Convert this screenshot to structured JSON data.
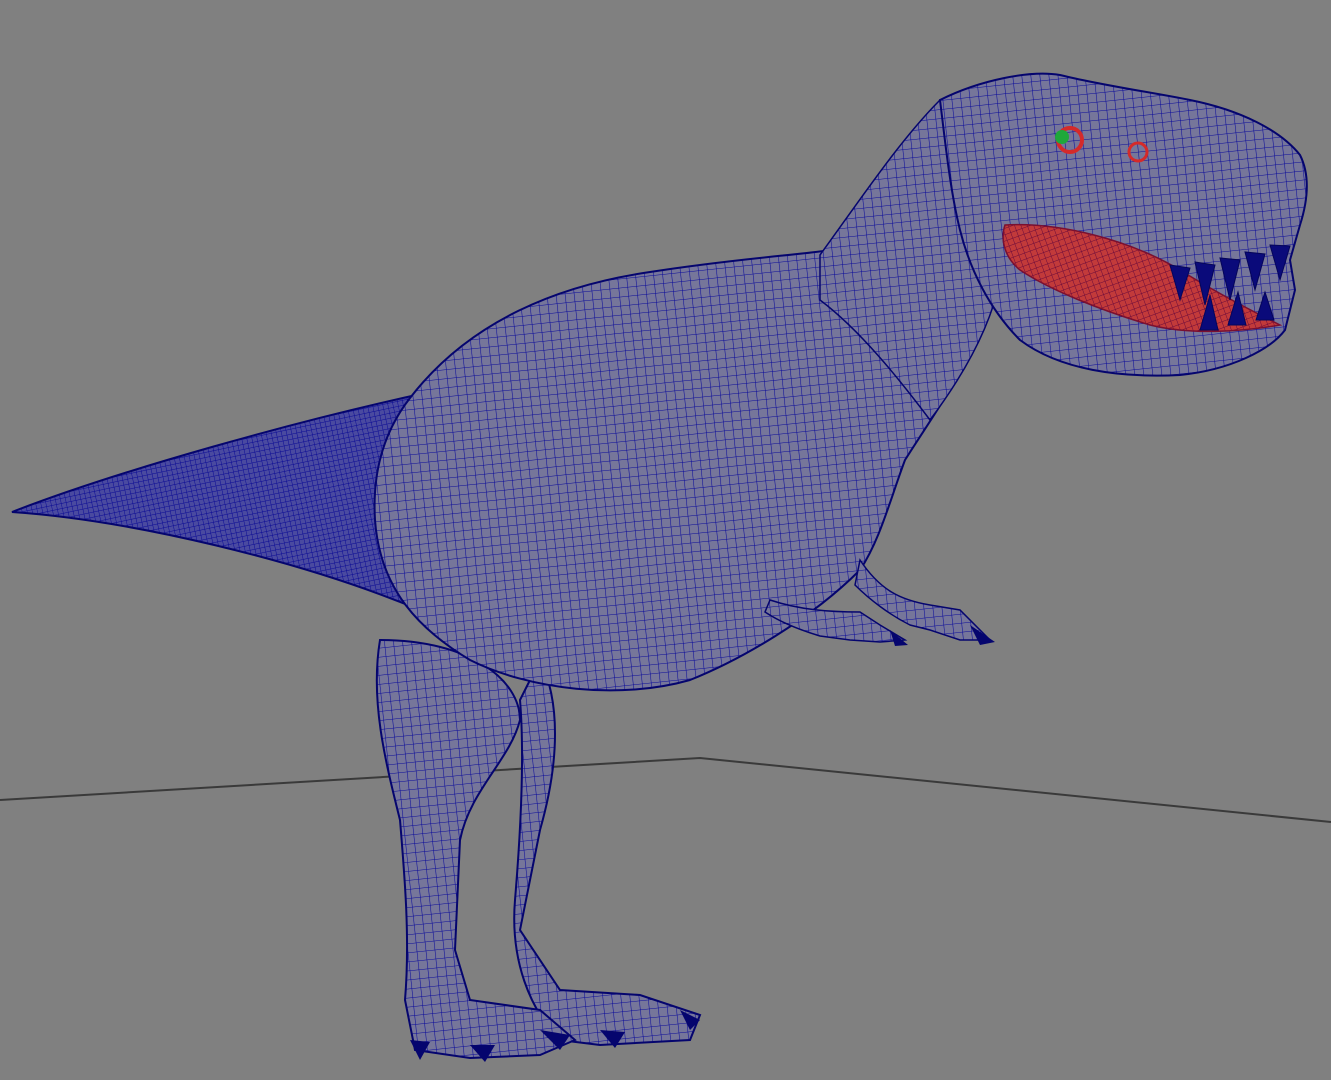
{
  "viewport": {
    "background_color": "#808080",
    "grid_line_color": "#3a3a3a",
    "grid_visible": true,
    "display_mode": "wireframe"
  },
  "model": {
    "subject": "tyrannosaurus",
    "wire_color": "#0b0b9a",
    "wire_color_dark": "#05056e",
    "fill_color": "#6a6a9a",
    "mouth_highlight_color": "#d42a2a",
    "eye_highlight_color": "#d42a2a",
    "selected_vertex_color": "#1fa83a"
  }
}
